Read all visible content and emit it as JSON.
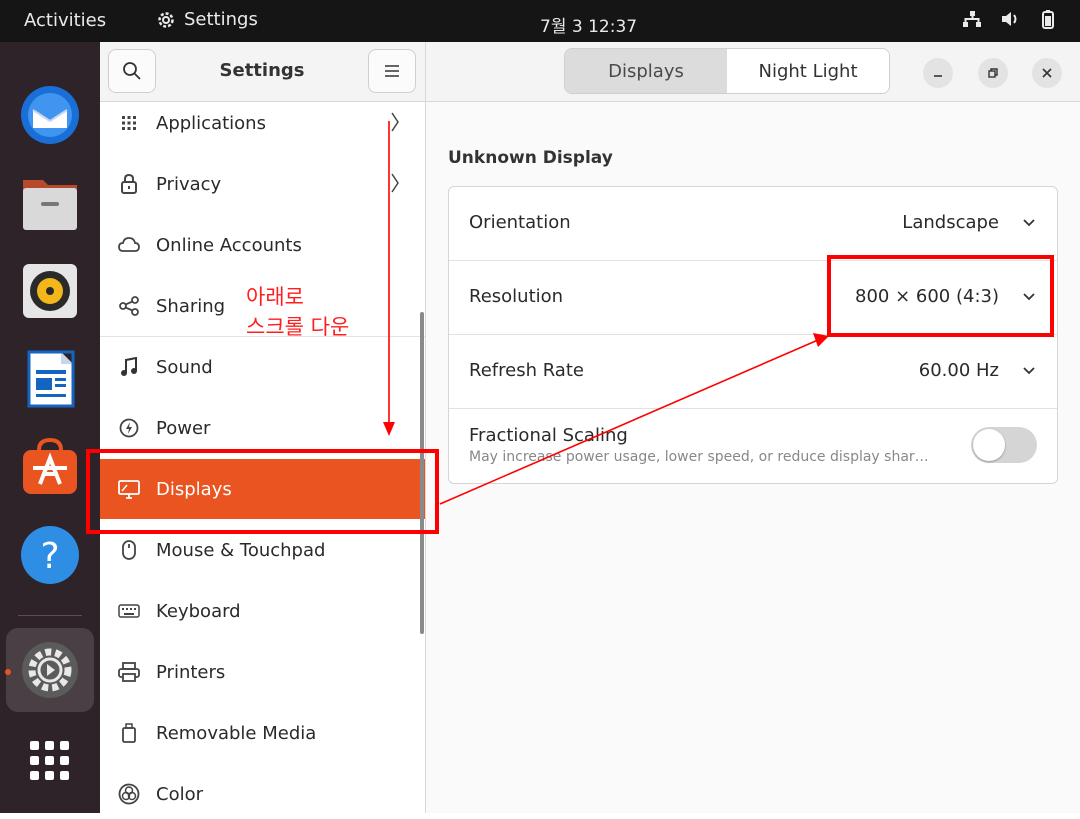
{
  "topbar": {
    "activities": "Activities",
    "app_name": "Settings",
    "clock": "7월 3  12:37",
    "tray_icons": [
      "network-icon",
      "volume-icon",
      "battery-icon"
    ]
  },
  "dock": {
    "items": [
      "thunderbird-icon",
      "files-icon",
      "rhythmbox-icon",
      "writer-icon",
      "software-icon",
      "help-icon",
      "settings-icon",
      "show-apps-icon"
    ]
  },
  "sidebar": {
    "title": "Settings",
    "items": [
      {
        "label": "Applications",
        "icon": "grid-icon"
      },
      {
        "label": "Privacy",
        "icon": "lock-icon"
      },
      {
        "label": "Online Accounts",
        "icon": "cloud-icon"
      },
      {
        "label": "Sharing",
        "icon": "share-icon"
      },
      {
        "label": "Sound",
        "icon": "music-note-icon"
      },
      {
        "label": "Power",
        "icon": "power-icon"
      },
      {
        "label": "Displays",
        "icon": "display-icon"
      },
      {
        "label": "Mouse & Touchpad",
        "icon": "mouse-icon"
      },
      {
        "label": "Keyboard",
        "icon": "keyboard-icon"
      },
      {
        "label": "Printers",
        "icon": "printer-icon"
      },
      {
        "label": "Removable Media",
        "icon": "media-icon"
      },
      {
        "label": "Color",
        "icon": "color-icon"
      }
    ]
  },
  "main": {
    "tabs": [
      "Displays",
      "Night Light"
    ],
    "display_name": "Unknown Display",
    "rows": {
      "orientation": {
        "label": "Orientation",
        "value": "Landscape"
      },
      "resolution": {
        "label": "Resolution",
        "value": "800 × 600 (4:3)"
      },
      "refresh": {
        "label": "Refresh Rate",
        "value": "60.00 Hz"
      },
      "scaling": {
        "label": "Fractional Scaling",
        "subtitle": "May increase power usage, lower speed, or reduce display shar…",
        "enabled": false
      }
    }
  },
  "annotation": {
    "line1": "아래로",
    "line2": "스크롤 다운",
    "color": "#ff0000"
  },
  "colors": {
    "accent": "#e95420",
    "dock": "#2d2329",
    "topbar": "#151515"
  }
}
